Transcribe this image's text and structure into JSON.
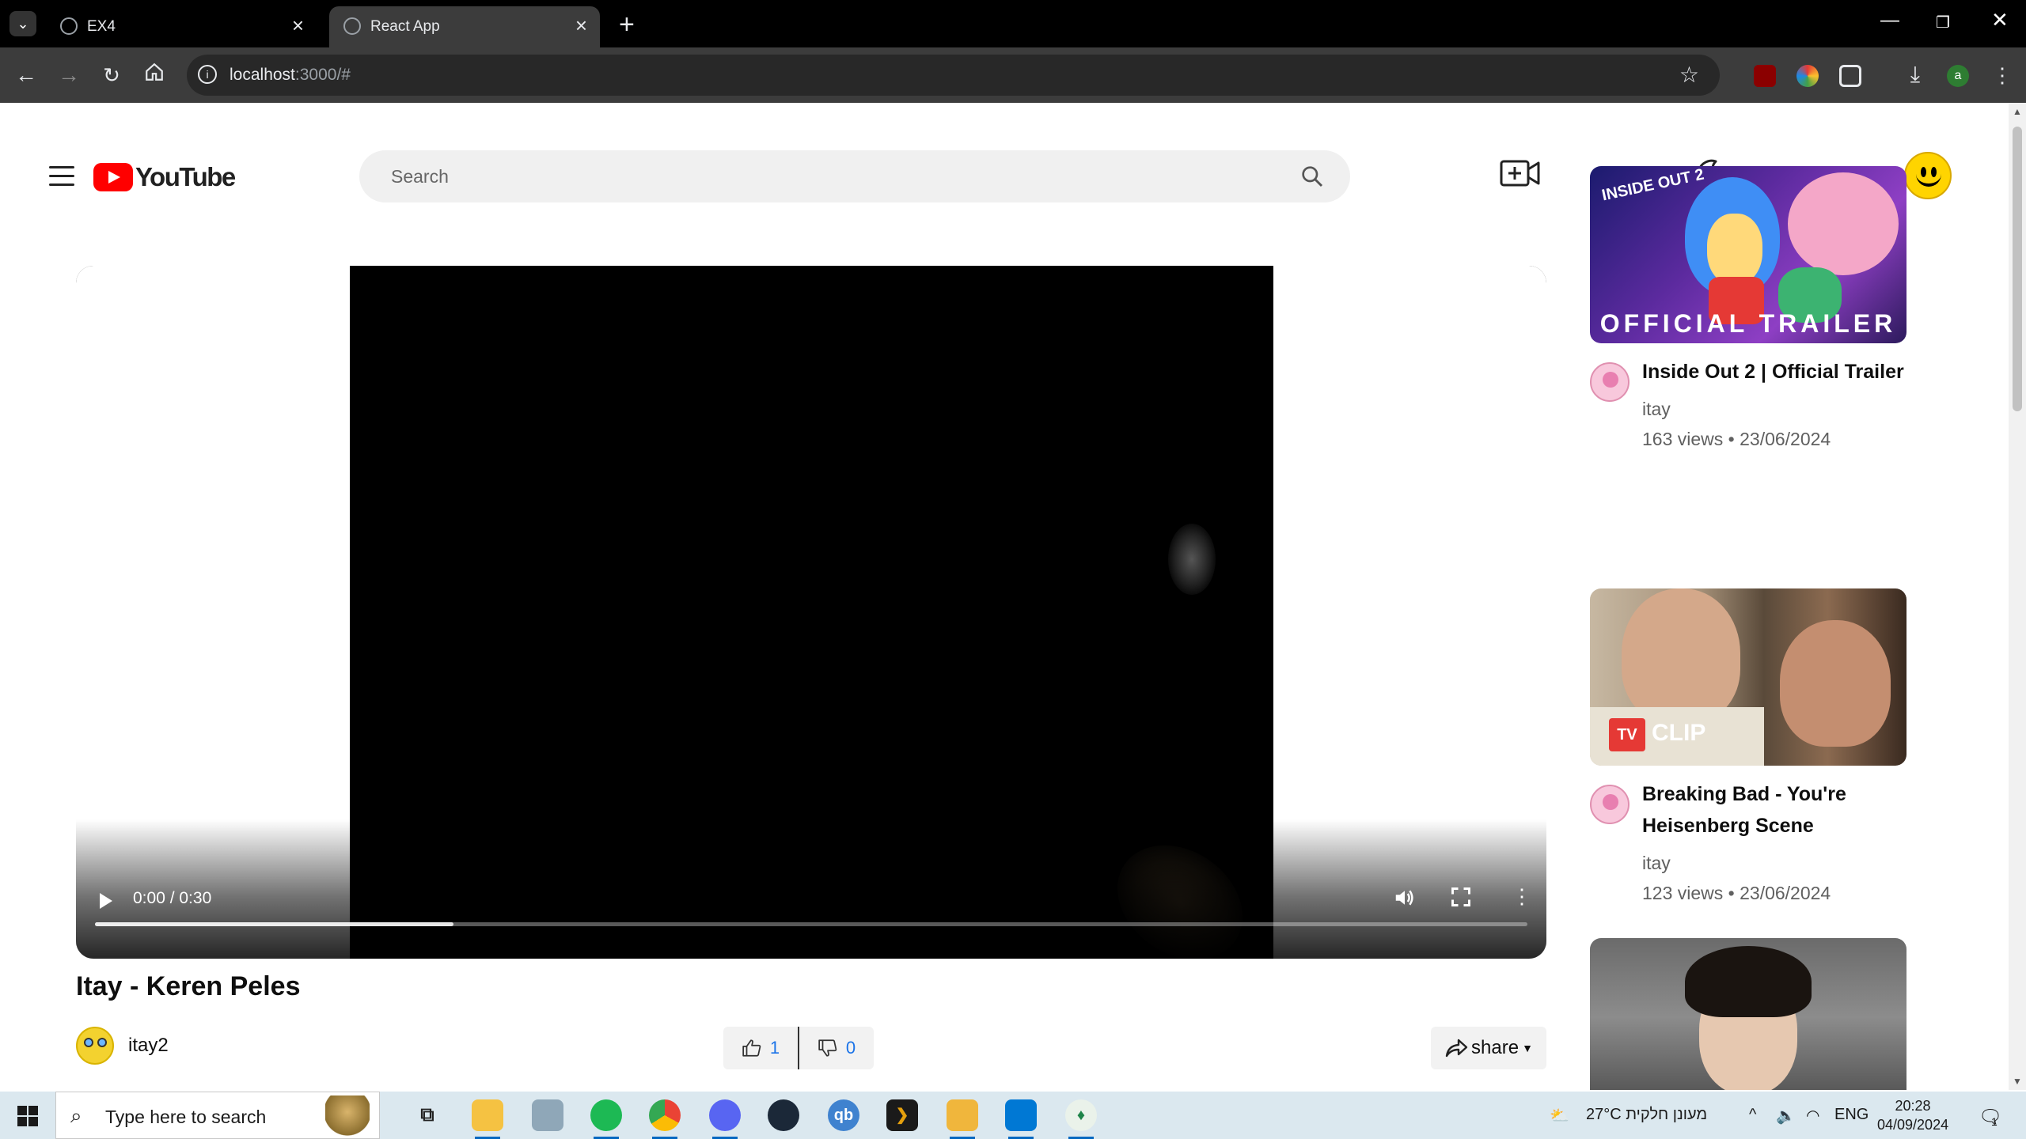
{
  "browser": {
    "tabs": [
      {
        "title": "EX4",
        "active": false
      },
      {
        "title": "React App",
        "active": true
      }
    ],
    "url_host": "localhost",
    "url_rest": ":3000/#"
  },
  "header": {
    "logo_text": "YouTube",
    "search_placeholder": "Search"
  },
  "video": {
    "time_display": "0:00 / 0:30",
    "progress_buffered": 0.25,
    "title": "Itay - Keren Peles",
    "uploader": "itay2",
    "likes": "1",
    "dislikes": "0",
    "share_label": "share"
  },
  "recommendations": [
    {
      "title": "Inside Out 2 | Official Trailer",
      "channel": "itay",
      "meta": "163 views • 23/06/2024",
      "thumb_logo": "INSIDE OUT 2",
      "thumb_caption": "OFFICIAL TRAILER"
    },
    {
      "title": "Breaking Bad - You're Heisenberg Scene",
      "channel": "itay",
      "meta": "123 views • 23/06/2024",
      "thumb_badge": "TV",
      "thumb_caption": "CLIP"
    },
    {
      "title": "",
      "channel": "",
      "meta": ""
    }
  ],
  "taskbar": {
    "search_text": "Type here to search",
    "weather": "27°C  מעונן חלקית",
    "language": "ENG",
    "time": "20:28",
    "date": "04/09/2024",
    "notification_count": "1"
  },
  "colors": {
    "brand_red": "#ff0000",
    "like_blue": "#1a73e8",
    "taskbar_bg": "#dbe8ef"
  }
}
